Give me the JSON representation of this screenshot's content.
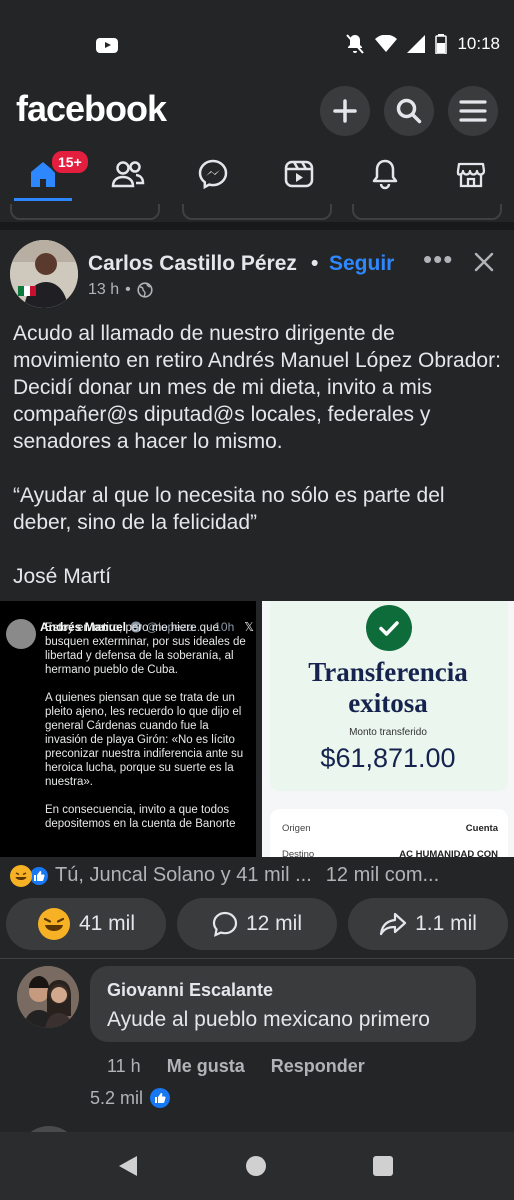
{
  "status_bar": {
    "time": "10:18",
    "icons": [
      "youtube-icon",
      "bell-off-icon",
      "wifi-icon",
      "signal-icon",
      "battery-icon"
    ]
  },
  "header": {
    "brand": "facebook",
    "buttons": [
      "add-icon",
      "search-icon",
      "menu-icon"
    ]
  },
  "nav": {
    "badge": "15+",
    "items": [
      "home-icon",
      "friends-icon",
      "messenger-icon",
      "video-icon",
      "notifications-icon",
      "marketplace-icon"
    ]
  },
  "post": {
    "author": "Carlos Castillo Pérez",
    "follow_separator": "•",
    "follow": "Seguir",
    "time": "13 h",
    "dot": "•",
    "more": "•••",
    "text": [
      "Acudo al llamado de nuestro dirigente de movimiento en retiro Andrés Manuel López Obrador: Decidí donar un mes de mi dieta, invito a mis compañer@s diputad@s locales, federales y senadores a hacer lo mismo.",
      "“Ayudar al que lo necesita no sólo es parte del deber, sino de la felicidad”",
      "José Martí"
    ]
  },
  "tweet": {
    "name": "Andrés Manuel",
    "handle": "@lopezo... · 10h",
    "paragraphs": [
      "Estoy en retiro, pero me hiere que busquen exterminar, por sus ideales de libertad y defensa de la soberanía, al hermano pueblo de Cuba.",
      "A quienes piensan que se trata de un pleito ajeno, les recuerdo lo que dijo el general Cárdenas cuando fue la invasión de playa Girón: «No es lícito preconizar nuestra indiferencia ante su heroica lucha, porque su suerte es la nuestra».",
      "En consecuencia, invito a que todos depositemos en la cuenta de Banorte"
    ]
  },
  "transfer": {
    "title_line1": "Transferencia",
    "title_line2": "exitosa",
    "label": "Monto transferido",
    "amount": "$61,871.00",
    "row1_label": "Origen",
    "row1_value": "Cuenta",
    "row2_label": "Destino",
    "row2_value": "AC HUMANIDAD CON"
  },
  "reactions": {
    "summary": "Tú, Juncal Solano y 41 mil ...",
    "comments": "12 mil com..."
  },
  "actions": {
    "react_count": "41 mil",
    "comment_count": "12 mil",
    "share_count": "1.1 mil"
  },
  "comment": {
    "name": "Giovanni Escalante",
    "text": "Ayude al pueblo mexicano primero",
    "time": "11 h",
    "like": "Me gusta",
    "reply": "Responder",
    "likes": "5.2 mil"
  },
  "colors": {
    "bg": "#242526",
    "accent": "#2d88ff",
    "badge": "#e41e3f"
  }
}
